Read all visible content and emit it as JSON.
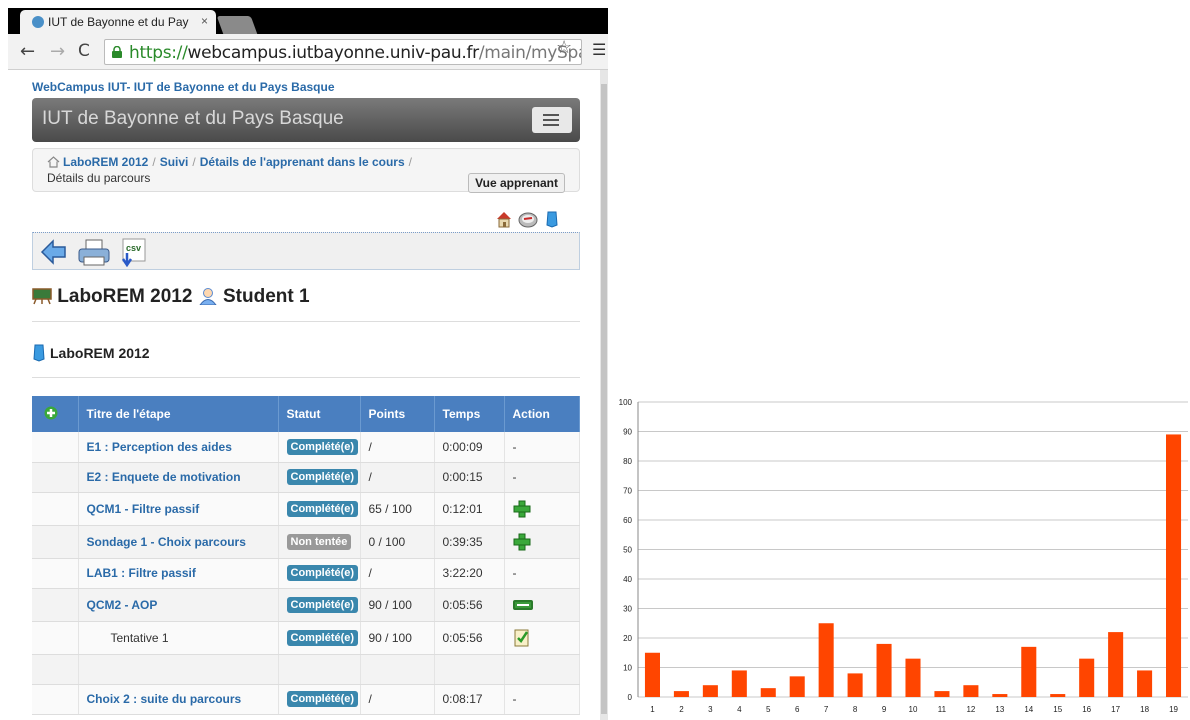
{
  "browser": {
    "tab_title": "IUT de Bayonne et du Pay",
    "tab_close": "×",
    "url_scheme": "https://",
    "url_host": "webcampus.iutbayonne.univ-pau.fr",
    "url_path": "/main/mySpace/l",
    "icons": [
      "back-icon",
      "forward-icon",
      "reload-icon",
      "lock-icon",
      "star-icon",
      "menu-icon"
    ]
  },
  "site": {
    "link": "WebCampus IUT- IUT de Bayonne et du Pays Basque",
    "navbar_title": "IUT de Bayonne et du Pays Basque"
  },
  "breadcrumb": {
    "items": [
      "LaboREM 2012",
      "Suivi",
      "Détails de l'apprenant dans le cours"
    ],
    "separator": "/",
    "current": "Détails du parcours",
    "button": "Vue apprenant"
  },
  "headings": {
    "course": "LaboREM 2012",
    "student": "Student 1",
    "learning_path": "LaboREM 2012"
  },
  "table": {
    "headers": [
      "Titre de l'étape",
      "Statut",
      "Points",
      "Temps",
      "Action"
    ],
    "rows": [
      {
        "title": "E1 : Perception des aides",
        "status": "Complété(e)",
        "points": "/",
        "time": "0:00:09",
        "action": "-",
        "link": true
      },
      {
        "title": "E2 : Enquete de motivation",
        "status": "Complété(e)",
        "points": "/",
        "time": "0:00:15",
        "action": "-",
        "link": true
      },
      {
        "title": "QCM1 - Filtre passif",
        "status": "Complété(e)",
        "points": "65 / 100",
        "time": "0:12:01",
        "action": "plus-icon",
        "link": true
      },
      {
        "title": "Sondage 1 - Choix parcours",
        "status": "Non tentée",
        "points": "0 / 100",
        "time": "0:39:35",
        "action": "plus-icon",
        "link": true
      },
      {
        "title": "LAB1 : Filtre passif",
        "status": "Complété(e)",
        "points": "/",
        "time": "3:22:20",
        "action": "-",
        "link": true
      },
      {
        "title": "QCM2 - AOP",
        "status": "Complété(e)",
        "points": "90 / 100",
        "time": "0:05:56",
        "action": "minus-icon",
        "link": true
      },
      {
        "title": "Tentative 1",
        "status": "Complété(e)",
        "points": "90 / 100",
        "time": "0:05:56",
        "action": "quiz-icon",
        "link": false
      },
      {
        "title": "",
        "status": "",
        "points": "",
        "time": "",
        "action": "",
        "link": false
      },
      {
        "title": "Choix 2 : suite du parcours",
        "status": "Complété(e)",
        "points": "/",
        "time": "0:08:17",
        "action": "-",
        "link": true
      }
    ]
  },
  "colors": {
    "accent": "#4a7fc0",
    "status_complete": "#3a87ad",
    "status_none": "#999999",
    "bar": "#ff4500"
  },
  "chart_data": {
    "type": "bar",
    "categories": [
      "1",
      "2",
      "3",
      "4",
      "5",
      "6",
      "7",
      "8",
      "9",
      "10",
      "11",
      "12",
      "13",
      "14",
      "15",
      "16",
      "17",
      "18",
      "19"
    ],
    "values": [
      15,
      2,
      4,
      9,
      3,
      7,
      25,
      8,
      18,
      13,
      2,
      4,
      1,
      17,
      1,
      13,
      22,
      9,
      89
    ],
    "yticks": [
      "0",
      "10",
      "20",
      "30",
      "40",
      "50",
      "60",
      "70",
      "80",
      "90",
      "100"
    ],
    "ylim": [
      0,
      100
    ],
    "title": "",
    "xlabel": "",
    "ylabel": "",
    "grid": true
  }
}
